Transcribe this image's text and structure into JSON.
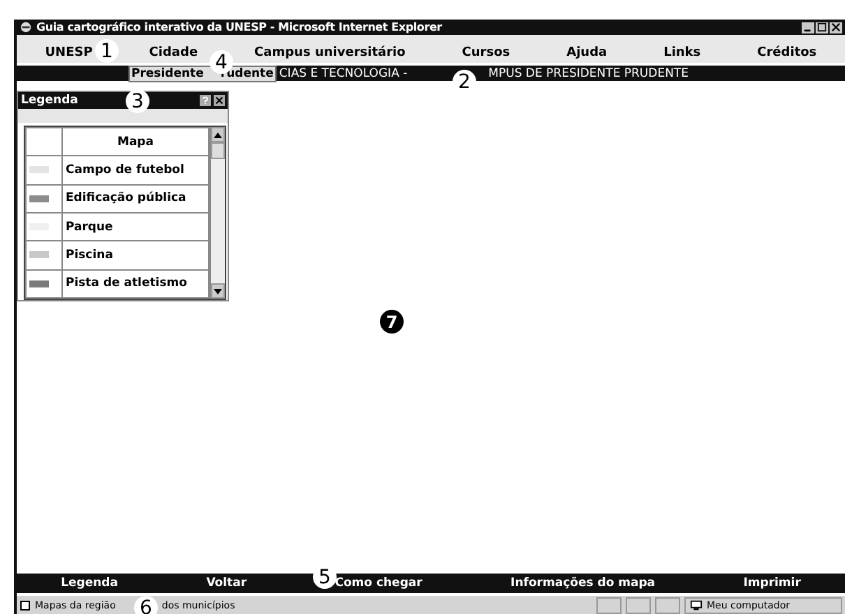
{
  "window": {
    "title": "Guia cartográfico interativo da UNESP - Microsoft Internet Explorer"
  },
  "menu": [
    "UNESP",
    "Cidade",
    "Campus universitário",
    "Cursos",
    "Ajuda",
    "Links",
    "Créditos"
  ],
  "breadcrumb": {
    "parts": [
      "CIAS E TECNOLOGIA -",
      "MPUS DE PRESIDENTE PRUDENTE"
    ],
    "popup": [
      "Presidente",
      "rudente"
    ]
  },
  "legend": {
    "title": "Legenda",
    "column": "Mapa",
    "items": [
      {
        "label": "Campo de futebol",
        "color": "#e4e4e4"
      },
      {
        "label": "Edificação pública",
        "color": "#8c8c8c"
      },
      {
        "label": "Parque",
        "color": "#f0f0f0"
      },
      {
        "label": "Piscina",
        "color": "#c8c8c8"
      },
      {
        "label": "Pista de atletismo",
        "color": "#7a7a7a"
      }
    ]
  },
  "bottom_bar": [
    "Legenda",
    "Voltar",
    "Como chegar",
    "Informações do mapa",
    "Imprimir"
  ],
  "status_bar": {
    "left": [
      "Mapas da região",
      "dos municípios"
    ],
    "zone": "Meu computador"
  },
  "callouts": [
    {
      "label": "1",
      "kind": "light"
    },
    {
      "label": "2",
      "kind": "light"
    },
    {
      "label": "3",
      "kind": "light"
    },
    {
      "label": "4",
      "kind": "light"
    },
    {
      "label": "5",
      "kind": "light"
    },
    {
      "label": "6",
      "kind": "light"
    },
    {
      "label": "7",
      "kind": "dark"
    }
  ]
}
